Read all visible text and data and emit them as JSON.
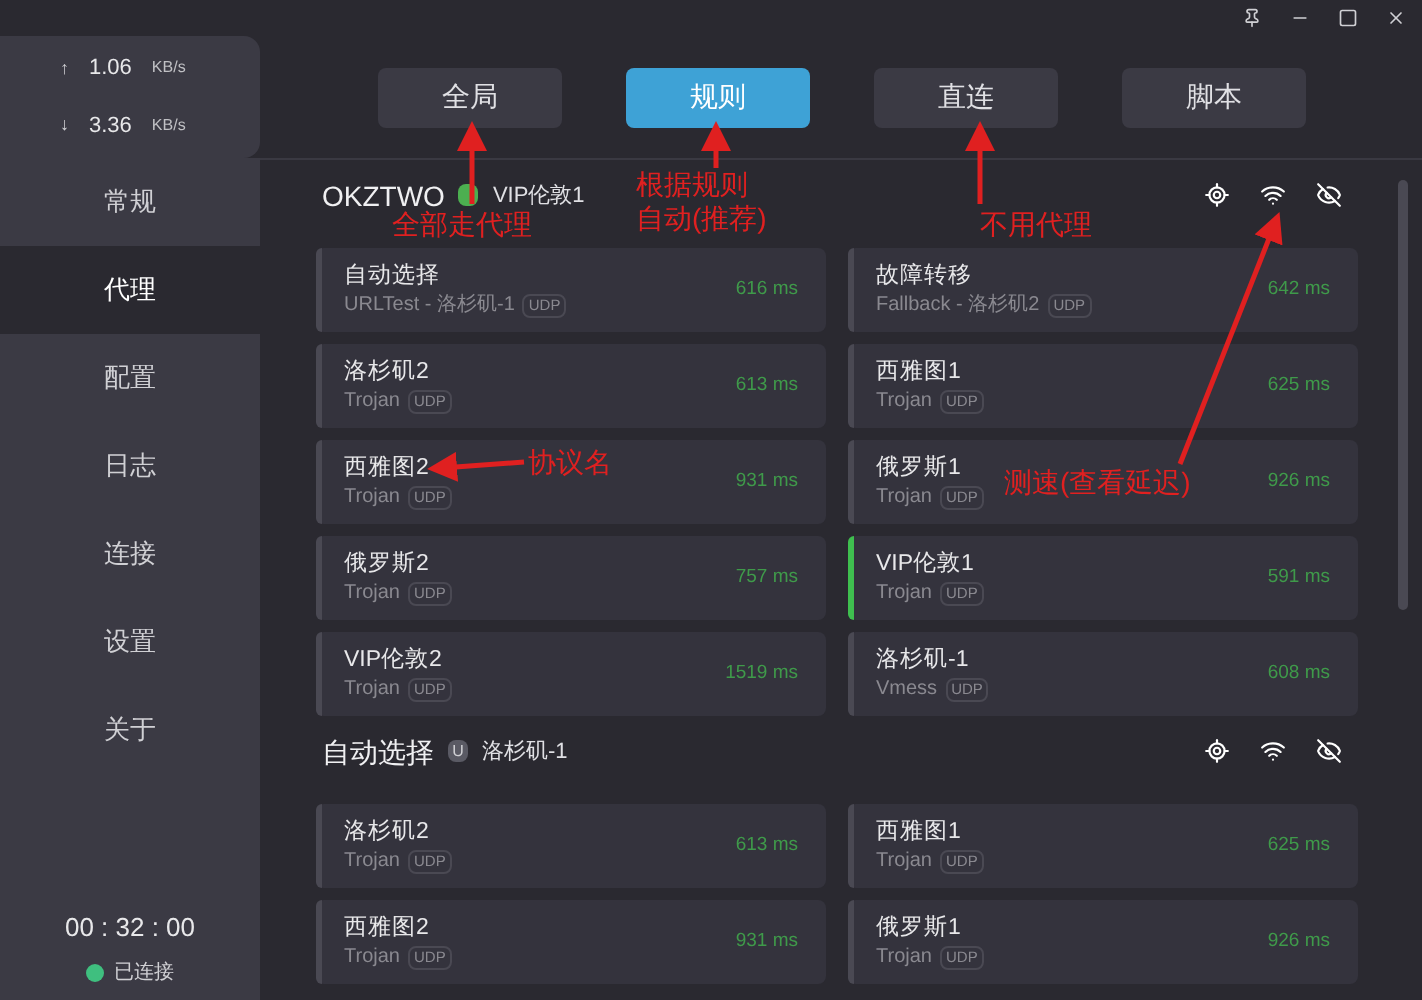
{
  "traffic": [
    {
      "arrow": "↑",
      "value": "1.06",
      "unit": "KB/s"
    },
    {
      "arrow": "↓",
      "value": "3.36",
      "unit": "KB/s"
    }
  ],
  "sidebar": {
    "items": [
      {
        "label": "常规",
        "selected": false
      },
      {
        "label": "代理",
        "selected": true
      },
      {
        "label": "配置",
        "selected": false
      },
      {
        "label": "日志",
        "selected": false
      },
      {
        "label": "连接",
        "selected": false
      },
      {
        "label": "设置",
        "selected": false
      },
      {
        "label": "关于",
        "selected": false
      }
    ],
    "uptime": "00 : 32 : 00",
    "status": {
      "label": "已连接",
      "color": "#3fbf7f"
    }
  },
  "modes": [
    {
      "label": "全局",
      "selected": false
    },
    {
      "label": "规则",
      "selected": true
    },
    {
      "label": "直连",
      "selected": false
    },
    {
      "label": "脚本",
      "selected": false
    }
  ],
  "groups": [
    {
      "name": "OKZTWO",
      "color": "#4caf50",
      "current": "VIP伦敦1",
      "proxies": [
        {
          "name": "自动选择",
          "type": "URLTest - 洛杉矶-1",
          "udp": "UDP",
          "latency": "616 ms",
          "selected": false
        },
        {
          "name": "故障转移",
          "type": "Fallback - 洛杉矶2",
          "udp": "UDP",
          "latency": "642 ms",
          "selected": false
        },
        {
          "name": "洛杉矶2",
          "type": "Trojan",
          "udp": "UDP",
          "latency": "613 ms",
          "selected": false
        },
        {
          "name": "西雅图1",
          "type": "Trojan",
          "udp": "UDP",
          "latency": "625 ms",
          "selected": false
        },
        {
          "name": "西雅图2",
          "type": "Trojan",
          "udp": "UDP",
          "latency": "931 ms",
          "selected": false
        },
        {
          "name": "俄罗斯1",
          "type": "Trojan",
          "udp": "UDP",
          "latency": "926 ms",
          "selected": false
        },
        {
          "name": "俄罗斯2",
          "type": "Trojan",
          "udp": "UDP",
          "latency": "757 ms",
          "selected": false
        },
        {
          "name": "VIP伦敦1",
          "type": "Trojan",
          "udp": "UDP",
          "latency": "591 ms",
          "selected": true
        },
        {
          "name": "VIP伦敦2",
          "type": "Trojan",
          "udp": "UDP",
          "latency": "1519 ms",
          "selected": false
        },
        {
          "name": "洛杉矶-1",
          "type": "Vmess",
          "udp": "UDP",
          "latency": "608 ms",
          "selected": false
        }
      ]
    },
    {
      "name": "自动选择",
      "color": "#5a5a64",
      "badge_text": "U",
      "current": "洛杉矶-1",
      "proxies": [
        {
          "name": "洛杉矶2",
          "type": "Trojan",
          "udp": "UDP",
          "latency": "613 ms",
          "selected": false
        },
        {
          "name": "西雅图1",
          "type": "Trojan",
          "udp": "UDP",
          "latency": "625 ms",
          "selected": false
        },
        {
          "name": "西雅图2",
          "type": "Trojan",
          "udp": "UDP",
          "latency": "931 ms",
          "selected": false
        },
        {
          "name": "俄罗斯1",
          "type": "Trojan",
          "udp": "UDP",
          "latency": "926 ms",
          "selected": false
        }
      ]
    }
  ],
  "annotations": [
    {
      "lines": [
        "全部走代理"
      ]
    },
    {
      "lines": [
        "根据规则",
        "自动(推荐)"
      ]
    },
    {
      "lines": [
        "不用代理"
      ]
    },
    {
      "lines": [
        "协议名"
      ]
    },
    {
      "lines": [
        "测速(查看延迟)"
      ]
    }
  ]
}
